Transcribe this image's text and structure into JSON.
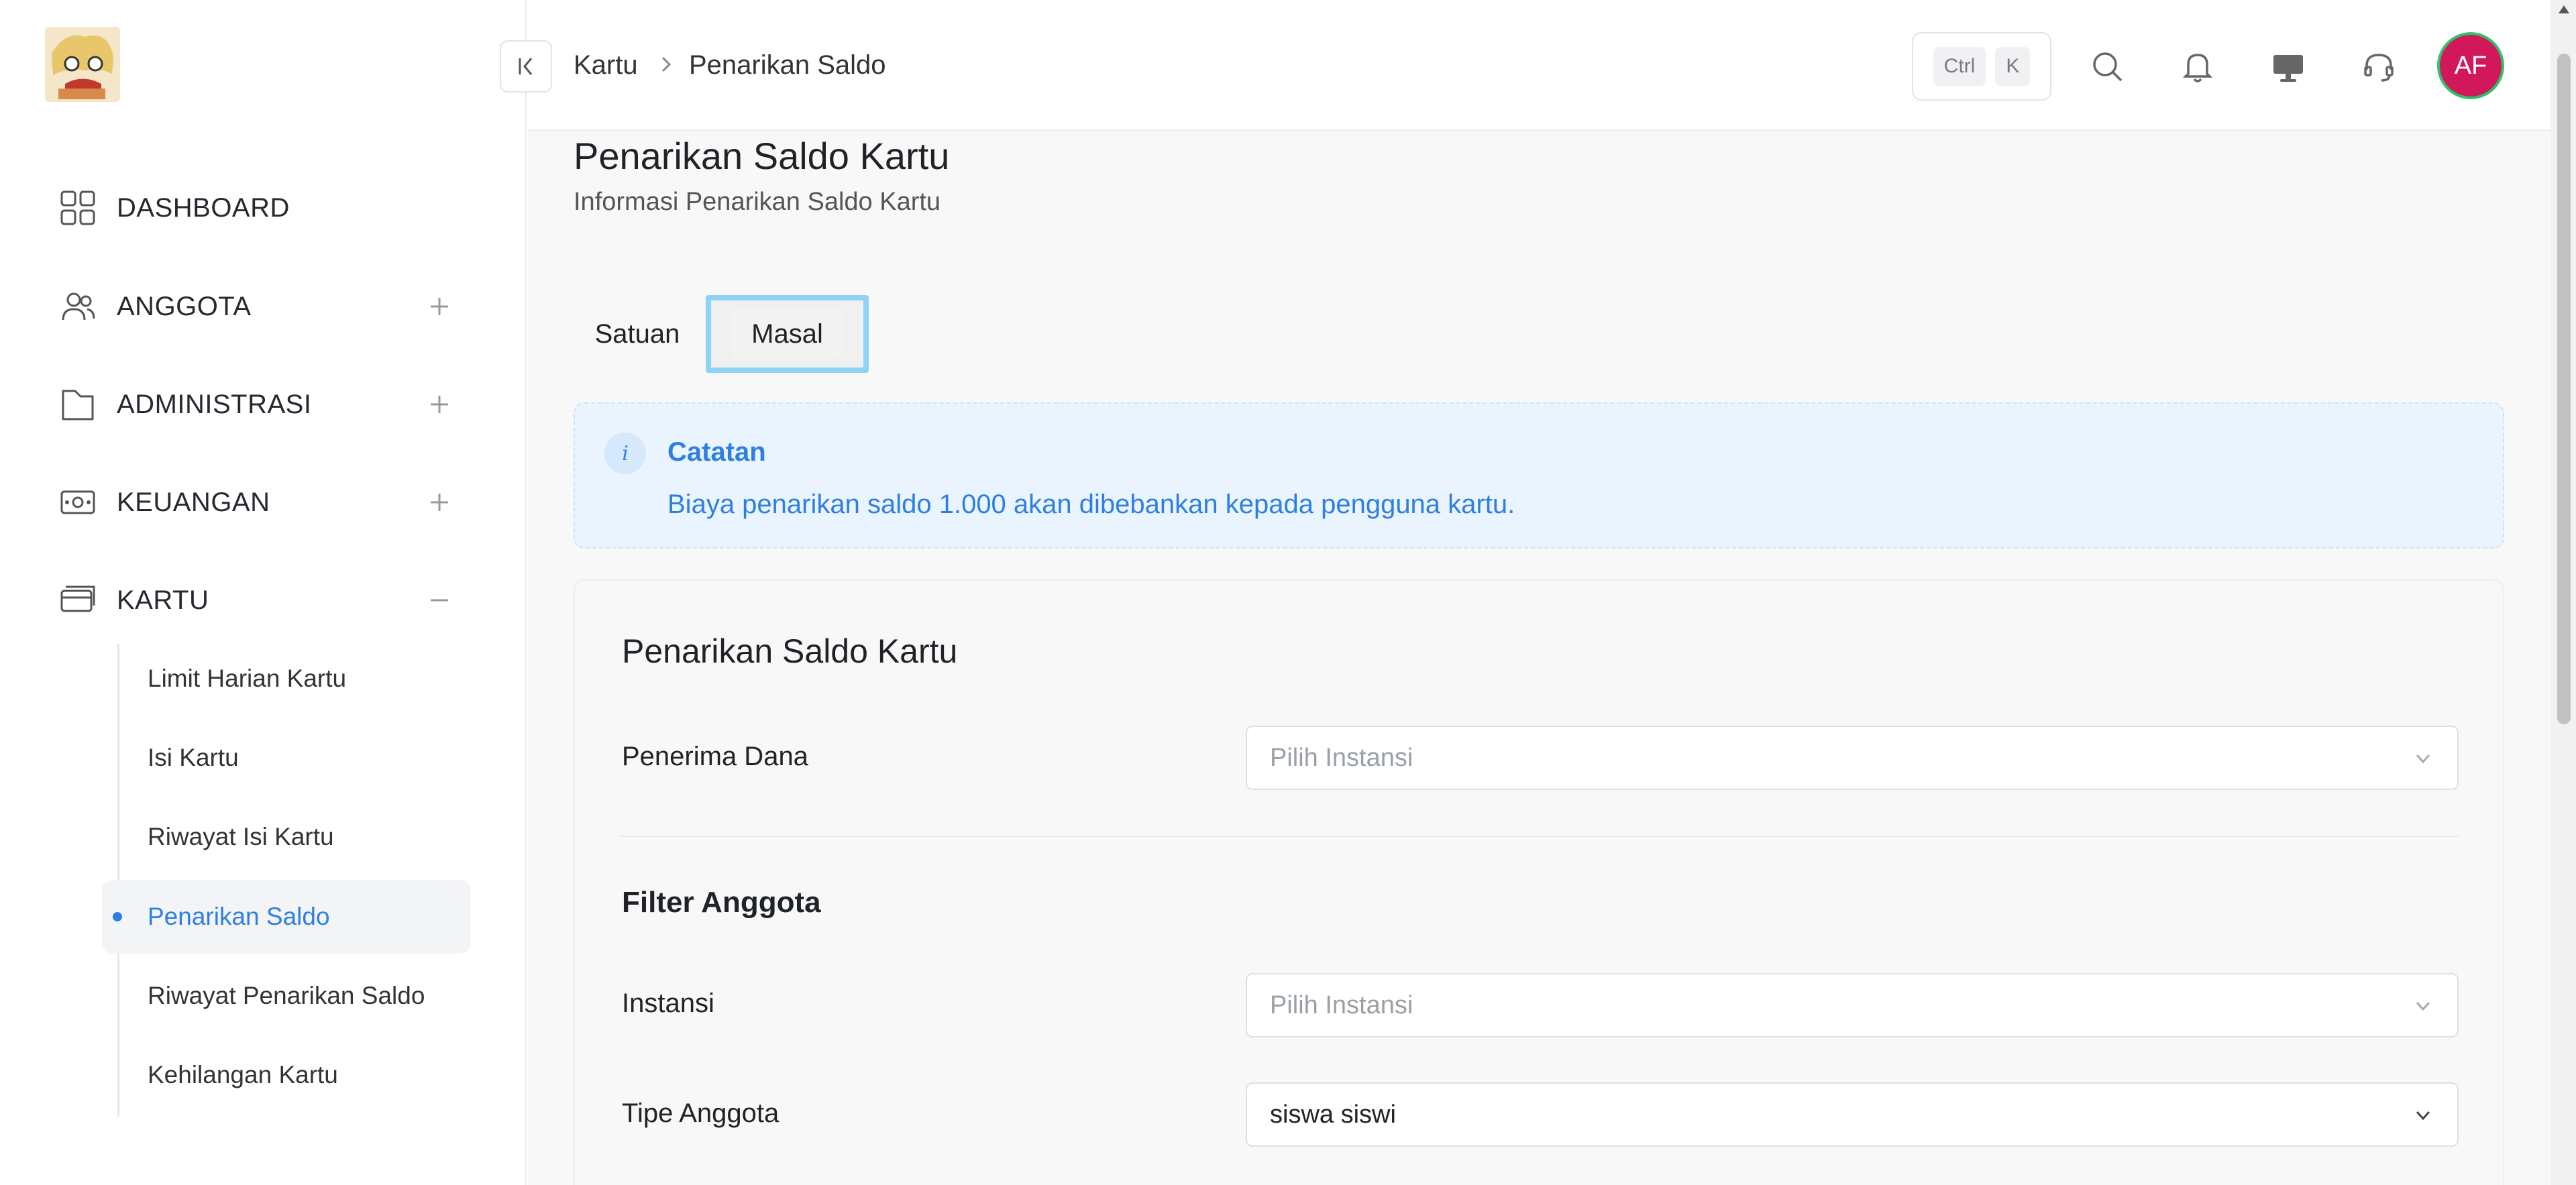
{
  "sidebar": {
    "items": [
      {
        "label": "DASHBOARD",
        "icon": "dashboard-grid-icon"
      },
      {
        "label": "ANGGOTA",
        "icon": "users-icon"
      },
      {
        "label": "ADMINISTRASI",
        "icon": "folder-icon"
      },
      {
        "label": "KEUANGAN",
        "icon": "money-icon"
      },
      {
        "label": "KARTU",
        "icon": "card-icon"
      }
    ],
    "submenu": [
      {
        "label": "Limit Harian Kartu"
      },
      {
        "label": "Isi Kartu"
      },
      {
        "label": "Riwayat Isi Kartu"
      },
      {
        "label": "Penarikan Saldo",
        "active": true
      },
      {
        "label": "Riwayat Penarikan Saldo"
      },
      {
        "label": "Kehilangan Kartu"
      }
    ]
  },
  "header": {
    "breadcrumb": [
      "Kartu",
      "Penarikan Saldo"
    ],
    "shortcut": [
      "Ctrl",
      "K"
    ],
    "avatar_initials": "AF",
    "accent": "#2f7fe0"
  },
  "page": {
    "title": "Penarikan Saldo Kartu",
    "subtitle": "Informasi Penarikan Saldo Kartu"
  },
  "tabs": [
    {
      "label": "Satuan"
    },
    {
      "label": "Masal",
      "active": true
    }
  ],
  "note": {
    "title": "Catatan",
    "text": "Biaya penarikan saldo 1.000 akan dibebankan kepada pengguna kartu."
  },
  "form": {
    "title": "Penarikan Saldo Kartu",
    "penerima_label": "Penerima Dana",
    "penerima_placeholder": "Pilih Instansi",
    "filter_title": "Filter Anggota",
    "instansi_label": "Instansi",
    "instansi_placeholder": "Pilih Instansi",
    "tipe_label": "Tipe Anggota",
    "tipe_value": "siswa siswi"
  }
}
